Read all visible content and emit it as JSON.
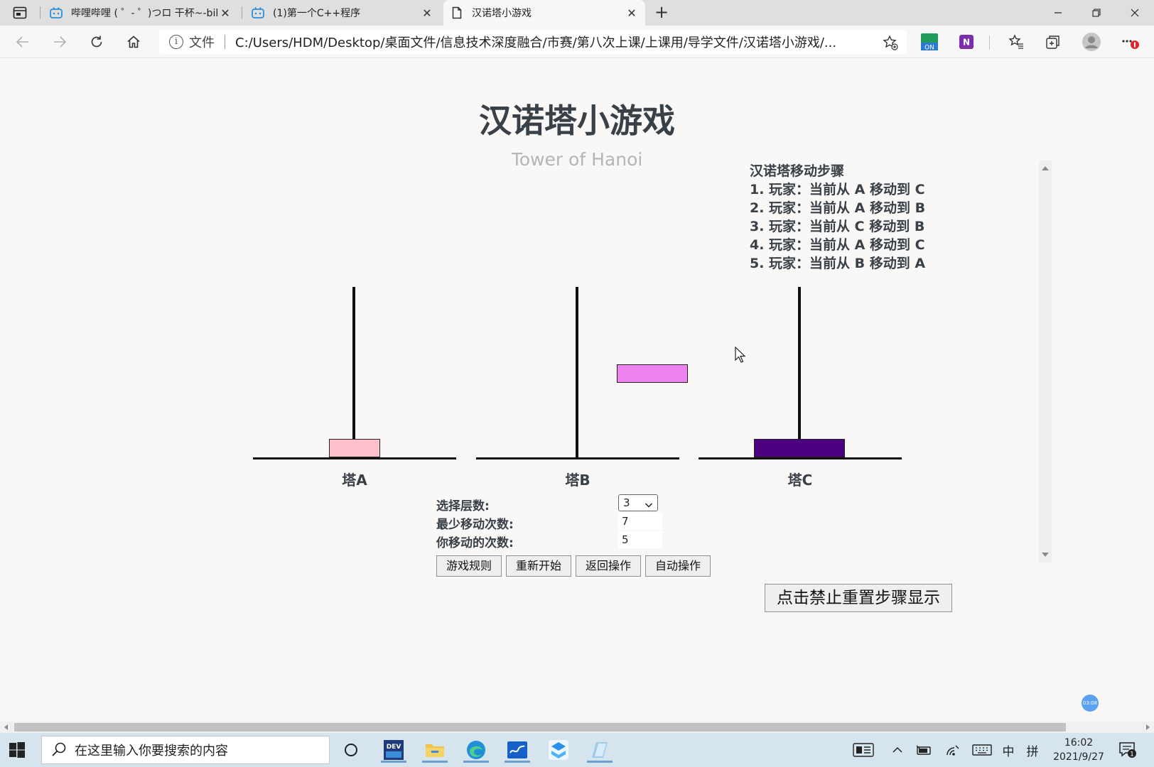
{
  "browser": {
    "tabs": [
      {
        "title": "哔哩哔哩 ( ゜- ゜)つロ 干杯~-bilibili",
        "close": "✕"
      },
      {
        "title": "(1)第一个C++程序",
        "close": "✕"
      },
      {
        "title": "汉诺塔小游戏",
        "close": "✕"
      }
    ],
    "new_tab": "+",
    "address": {
      "scheme_label": "文件",
      "url": "C:/Users/HDM/Desktop/桌面文件/信息技术深度融合/市赛/第八次上课/上课用/导学文件/汉诺塔小游戏/..."
    },
    "ext_on_label": "ON",
    "ext_n_label": "N"
  },
  "page": {
    "title": "汉诺塔小游戏",
    "subtitle": "Tower of Hanoi",
    "steps": {
      "title": "汉诺塔移动步骤",
      "items": [
        "1. 玩家：当前从 A 移动到 C",
        "2. 玩家：当前从 A 移动到 B",
        "3. 玩家：当前从 C 移动到 B",
        "4. 玩家：当前从 A 移动到 C",
        "5. 玩家：当前从 B 移动到 A"
      ]
    },
    "towers": [
      {
        "label": "塔A"
      },
      {
        "label": "塔B"
      },
      {
        "label": "塔C"
      }
    ],
    "disk_colors": {
      "small": "#ffc0cb",
      "medium": "#ee82ee",
      "large": "#4b0082"
    },
    "controls": {
      "level_label": "选择层数:",
      "level_value": "3",
      "min_moves_label": "最少移动次数:",
      "min_moves_value": "7",
      "your_moves_label": "你移动的次数:",
      "your_moves_value": "5",
      "buttons": {
        "rules": "游戏规则",
        "restart": "重新开始",
        "undo": "返回操作",
        "auto": "自动操作"
      },
      "toggle_steps": "点击禁止重置步骤显示"
    },
    "rec_badge": "03:08"
  },
  "taskbar": {
    "search_placeholder": "在这里输入你要搜索的内容",
    "dev_label": "DEV",
    "ime_lang": "中",
    "ime_mode": "拼",
    "time": "16:02",
    "date": "2021/9/27",
    "notification_count": "1"
  }
}
